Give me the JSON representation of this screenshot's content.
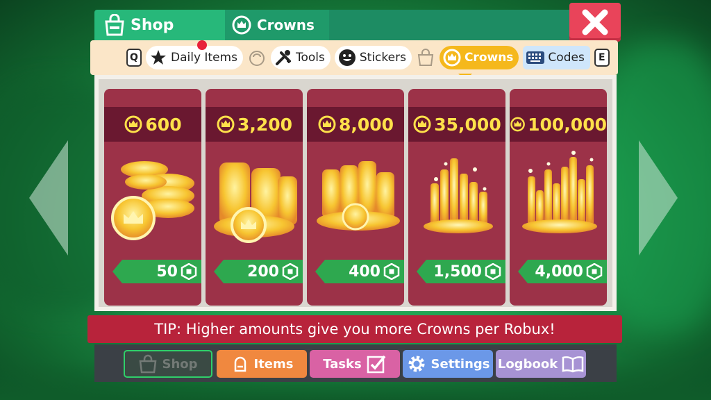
{
  "window": {
    "tabs": [
      {
        "label": "Shop",
        "icon": "shop-bag-icon"
      },
      {
        "label": "Crowns",
        "icon": "crown-coin-icon"
      }
    ],
    "close_icon": "close-icon"
  },
  "category_bar": {
    "key_left": "Q",
    "key_right": "E",
    "items": [
      {
        "label": "Daily Items",
        "icon": "star-icon",
        "badge_color": "#e8213a"
      },
      {
        "label": "",
        "icon": "bag-outline-icon"
      },
      {
        "label": "Tools",
        "icon": "tools-icon"
      },
      {
        "label": "Stickers",
        "icon": "smiley-icon"
      },
      {
        "label": "",
        "icon": "shop-bag-icon"
      },
      {
        "label": "Crowns",
        "icon": "crown-coin-icon",
        "active": true
      },
      {
        "label": "Codes",
        "icon": "keyboard-icon"
      }
    ]
  },
  "offers": [
    {
      "crowns": "600",
      "price": "50"
    },
    {
      "crowns": "3,200",
      "price": "200"
    },
    {
      "crowns": "8,000",
      "price": "400"
    },
    {
      "crowns": "35,000",
      "price": "1,500"
    },
    {
      "crowns": "100,000",
      "price": "4,000"
    }
  ],
  "tip": "TIP: Higher amounts give you more Crowns per Robux!",
  "bottom_nav": {
    "shop": "Shop",
    "items": "Items",
    "tasks": "Tasks",
    "settings": "Settings",
    "logbook": "Logbook"
  },
  "colors": {
    "card_bg": "#9c3248",
    "card_header": "#6a1830",
    "crown_text": "#ffe14a",
    "price_tag": "#2ea84f",
    "tip_bar": "#b8233b",
    "active_category": "#f5b81c"
  }
}
